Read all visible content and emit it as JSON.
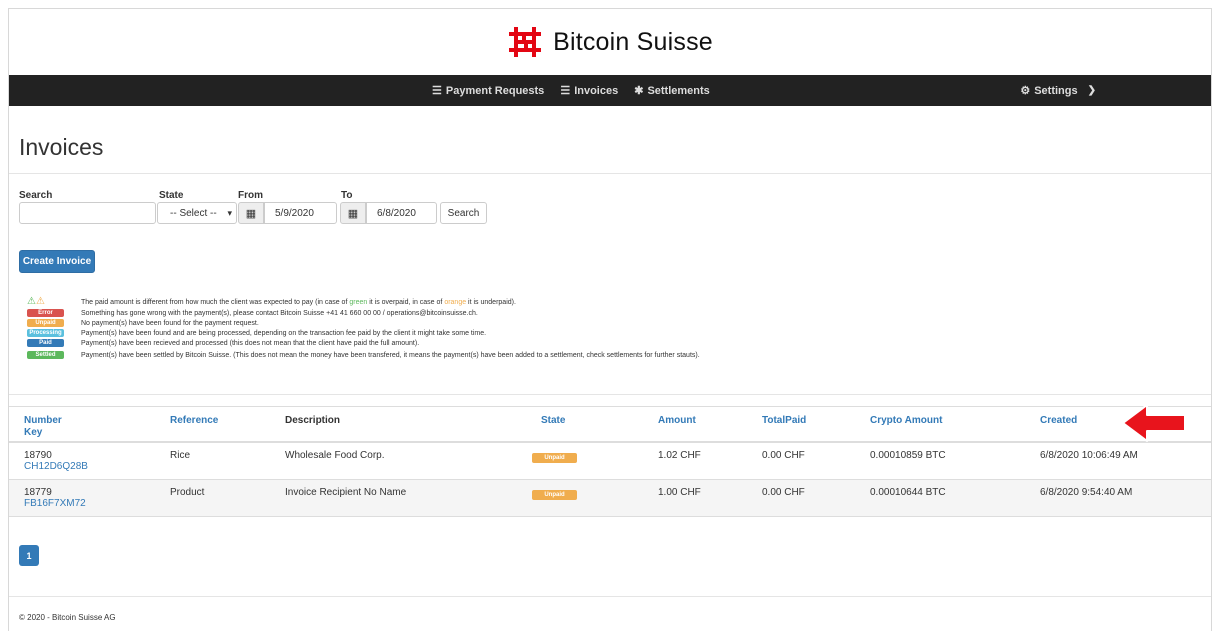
{
  "brand": {
    "name": "Bitcoin Suisse",
    "color": "#e30613"
  },
  "nav": {
    "items": [
      {
        "label": "Payment Requests",
        "icon": "list-icon"
      },
      {
        "label": "Invoices",
        "icon": "list-icon"
      },
      {
        "label": "Settlements",
        "icon": "gear-icon"
      }
    ],
    "settings_label": "Settings"
  },
  "page": {
    "title": "Invoices"
  },
  "filters": {
    "search_label": "Search",
    "search_value": "",
    "state_label": "State",
    "state_value": "-- Select --",
    "from_label": "From",
    "from_value": "5/9/2020",
    "to_label": "To",
    "to_value": "6/8/2020",
    "search_button": "Search"
  },
  "create_button": "Create Invoice",
  "legend": {
    "warning": {
      "prefix": "The paid amount is different from how much the client was expected to pay (in case of ",
      "green": "green",
      "middle": " it is overpaid, in case of ",
      "orange": "orange",
      "suffix": " it is underpaid)."
    },
    "items": [
      {
        "badge": "Error",
        "color": "#d9534f",
        "text": "Something has gone wrong with the payment(s), please contact Bitcoin Suisse +41 41 660 00 00 / operations@bitcoinsuisse.ch."
      },
      {
        "badge": "Unpaid",
        "color": "#f0ad4e",
        "text": "No payment(s) have been found for the payment request."
      },
      {
        "badge": "Processing",
        "color": "#5bc0de",
        "text": "Payment(s) have been found and are being processed, depending on the transaction fee paid by the client it might take some time."
      },
      {
        "badge": "Paid",
        "color": "#337ab7",
        "text": "Payment(s) have been recieved and processed (this does not mean that the client have paid the full amount)."
      },
      {
        "badge": "Settled",
        "color": "#5cb85c",
        "text": "Payment(s) have been settled by Bitcoin Suisse. (This does not mean the money have been transfered, it means the payment(s) have been added to a settlement, check settlements for further stauts)."
      }
    ]
  },
  "table": {
    "headers": {
      "number": "Number",
      "key": "Key",
      "reference": "Reference",
      "description": "Description",
      "state": "State",
      "amount": "Amount",
      "total_paid": "TotalPaid",
      "crypto_amount": "Crypto Amount",
      "created": "Created"
    },
    "rows": [
      {
        "number": "18790",
        "key": "CH12D6Q28B",
        "reference": "Rice",
        "description": "Wholesale Food Corp.",
        "state": "Unpaid",
        "amount": "1.02 CHF",
        "total_paid": "0.00 CHF",
        "crypto_amount": "0.00010859 BTC",
        "created": "6/8/2020 10:06:49 AM"
      },
      {
        "number": "18779",
        "key": "FB16F7XM72",
        "reference": "Product",
        "description": "Invoice Recipient No Name",
        "state": "Unpaid",
        "amount": "1.00 CHF",
        "total_paid": "0.00 CHF",
        "crypto_amount": "0.00010644 BTC",
        "created": "6/8/2020 9:54:40 AM"
      }
    ]
  },
  "pagination": {
    "current": "1"
  },
  "footer": "© 2020 - Bitcoin Suisse AG"
}
